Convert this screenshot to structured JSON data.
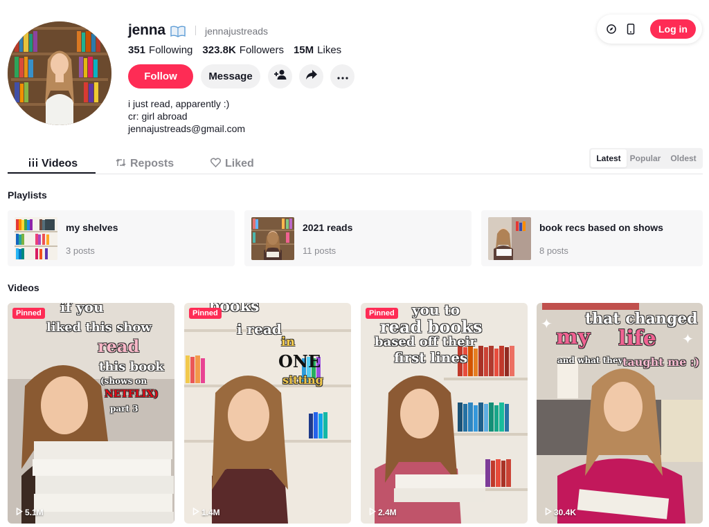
{
  "topbar": {
    "login_label": "Log in",
    "icons": [
      "compass-icon",
      "mobile-icon"
    ]
  },
  "profile": {
    "username": "jenna",
    "handle": "jennajustreads",
    "stats": [
      {
        "value": "351",
        "label": "Following"
      },
      {
        "value": "323.8K",
        "label": "Followers"
      },
      {
        "value": "15M",
        "label": "Likes"
      }
    ],
    "follow_label": "Follow",
    "message_label": "Message",
    "bio": [
      "i just read, apparently :)",
      "cr: girl abroad",
      "jennajustreads@gmail.com"
    ]
  },
  "tabs": [
    {
      "label": "Videos",
      "active": true
    },
    {
      "label": "Reposts",
      "active": false
    },
    {
      "label": "Liked",
      "active": false
    }
  ],
  "sort": {
    "options": [
      "Latest",
      "Popular",
      "Oldest"
    ],
    "selected": "Latest"
  },
  "playlists_title": "Playlists",
  "playlists": [
    {
      "name": "my shelves",
      "posts": "3 posts"
    },
    {
      "name": "2021 reads",
      "posts": "11 posts"
    },
    {
      "name": "book recs based on shows",
      "posts": "8 posts"
    }
  ],
  "videos_title": "Videos",
  "videos": [
    {
      "pinned": "Pinned",
      "views": "5.1M",
      "overlay": [
        "if you",
        "liked this show",
        "read",
        "this book",
        "(shows on",
        "NETFLIX)",
        "part 3"
      ]
    },
    {
      "pinned": "Pinned",
      "views": "1.4M",
      "overlay": [
        "books",
        "i read",
        "in",
        "ONE",
        "sitting"
      ]
    },
    {
      "pinned": "Pinned",
      "views": "2.4M",
      "overlay": [
        "you to",
        "read books",
        "based off their",
        "first lines"
      ]
    },
    {
      "views": "30.4K",
      "overlay": [
        "that changed",
        "my",
        "life",
        "and what they",
        "taught me :)"
      ]
    }
  ],
  "colors": {
    "accent": "#fe2c55",
    "text": "#161823",
    "muted": "#8a8b91"
  }
}
